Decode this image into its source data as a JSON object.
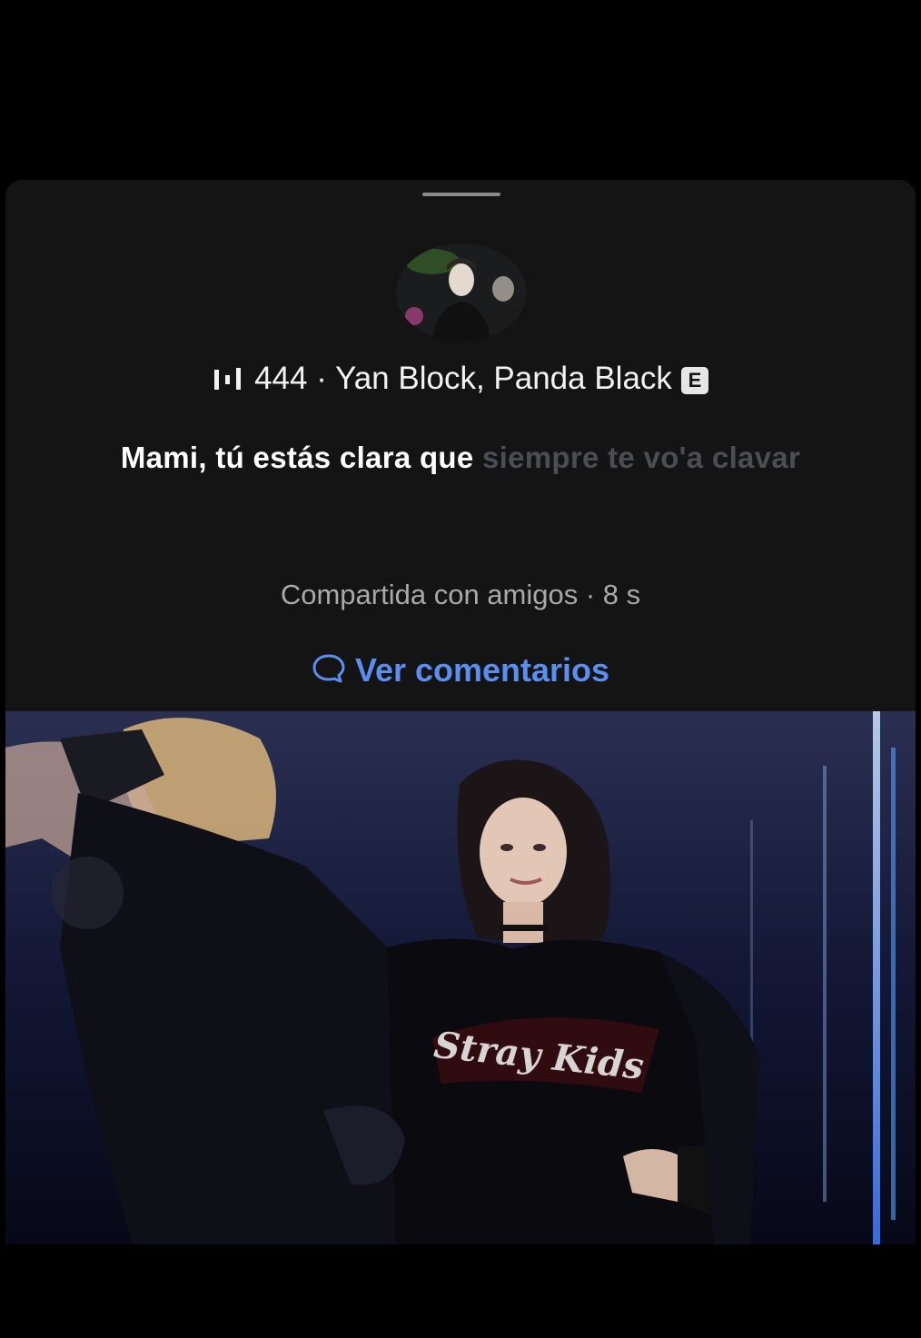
{
  "song": {
    "plays": "444",
    "separator": "·",
    "artists": "Yan Block, Panda Black",
    "explicit_label": "E"
  },
  "lyric": {
    "sung": "Mami, tú estás clara que",
    "unsung": "siempre te vo'a clavar"
  },
  "share_status": "Compartida con amigos · 8 s",
  "comments_link": "Ver comentarios",
  "photo": {
    "shirt_text": "Stray Kids"
  },
  "colors": {
    "sheet_background": "#141414",
    "link_blue": "#5b8ef0",
    "unsung_lyric": "#4a4d52"
  },
  "icons": [
    "audio-bars-icon",
    "explicit-icon",
    "comment-bubble-icon"
  ]
}
